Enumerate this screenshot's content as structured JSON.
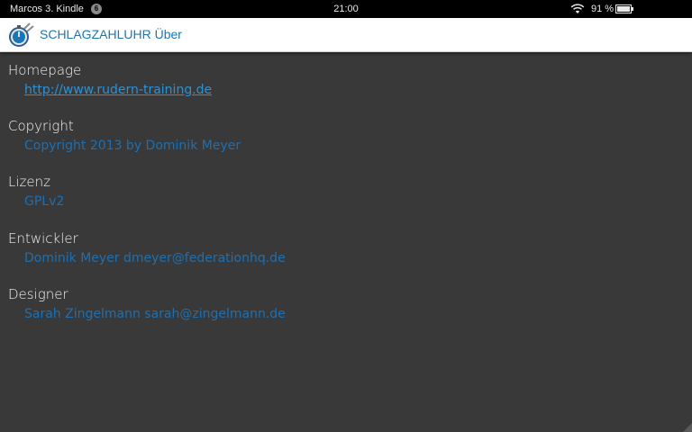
{
  "status_bar": {
    "device_name": "Marcos 3. Kindle",
    "notification_count": "6",
    "time": "21:00",
    "battery_percent": "91 %",
    "icons": [
      "wifi-icon",
      "battery-icon"
    ]
  },
  "action_bar": {
    "title": "SCHLAGZAHLUHR Über",
    "icon": "stopwatch-icon"
  },
  "sections": [
    {
      "title": "Homepage",
      "value": "http://www.rudern-training.de"
    },
    {
      "title": "Copyright",
      "value": "Copyright 2013 by Dominik Meyer"
    },
    {
      "title": "Lizenz",
      "value": "GPLv2"
    },
    {
      "title": "Entwickler",
      "value": "Dominik Meyer dmeyer@federationhq.de"
    },
    {
      "title": "Designer",
      "value": "Sarah Zingelmann sarah@zingelmann.de"
    }
  ],
  "colors": {
    "background": "#393939",
    "accent": "#1a77b3",
    "link": "#2b92d8",
    "heading": "#f2f2f2"
  }
}
